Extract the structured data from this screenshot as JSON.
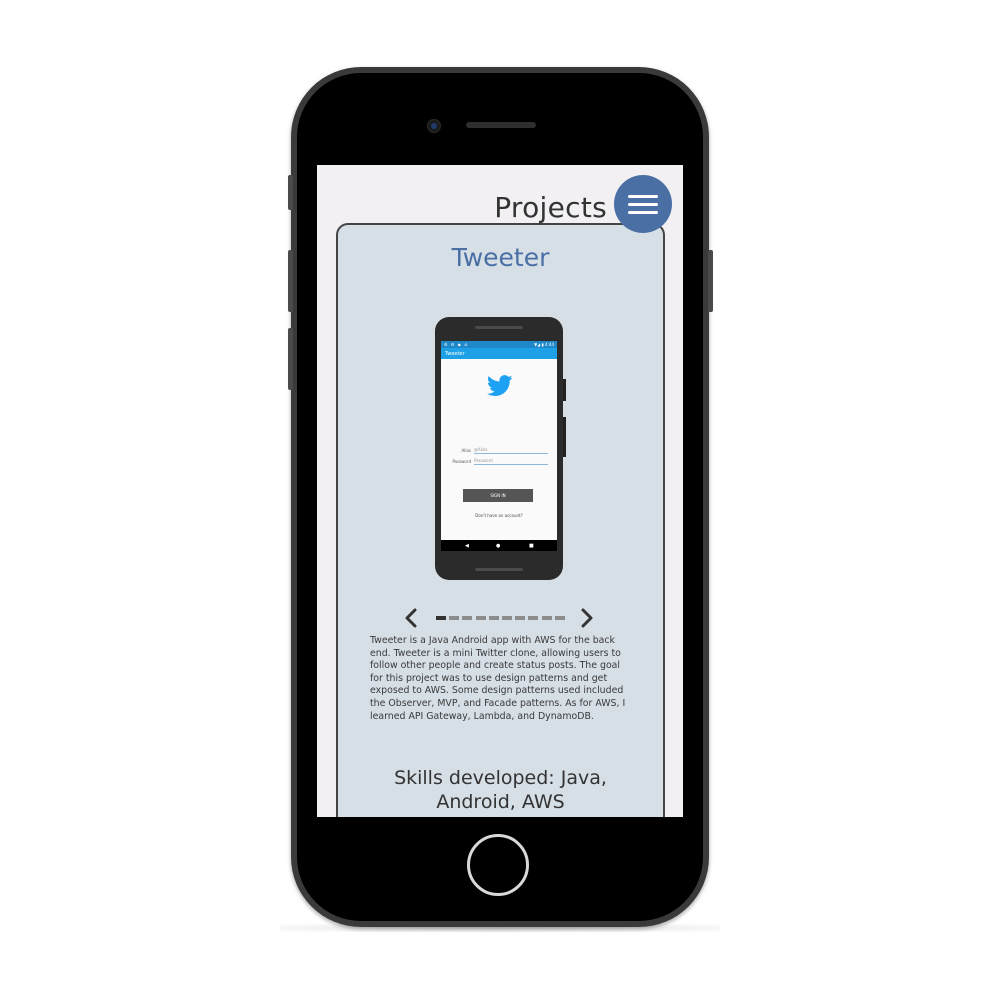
{
  "header": {
    "title": "Projects",
    "menu_icon": "hamburger-icon"
  },
  "project": {
    "title": "Tweeter",
    "description": "Tweeter is a Java Android app with AWS for the back end. Tweeter is a mini Twitter clone, allowing users to follow other people and create status posts. The goal for this project was to use design patterns and get exposed to AWS. Some design patterns used included the Observer, MVP, and Facade patterns. As for AWS, I learned API Gateway, Lambda, and DynamoDB.",
    "skills": "Skills developed: Java, Android, AWS"
  },
  "preview": {
    "app_title": "Tweeter",
    "status_left": "⚙ ⚙ ◆ ⊘",
    "status_right": "▼◢ ▮ 4:44",
    "alias_label": "Alias",
    "alias_value": "@Alias",
    "password_label": "Password",
    "password_value": "Password",
    "signin_label": "SIGN IN",
    "register_link": "Don't have an account?",
    "nav_back": "◀",
    "nav_home": "●",
    "nav_recent": "■"
  },
  "carousel": {
    "prev_icon": "chevron-left-icon",
    "next_icon": "chevron-right-icon",
    "prev_glyph": "‹",
    "next_glyph": "›",
    "slide_count": 10,
    "active_index": 0
  },
  "colors": {
    "accent": "#4a6fa5",
    "card_bg": "#d6dee6",
    "screen_bg": "#f2f0f3",
    "twitter_blue": "#1da1f2"
  }
}
